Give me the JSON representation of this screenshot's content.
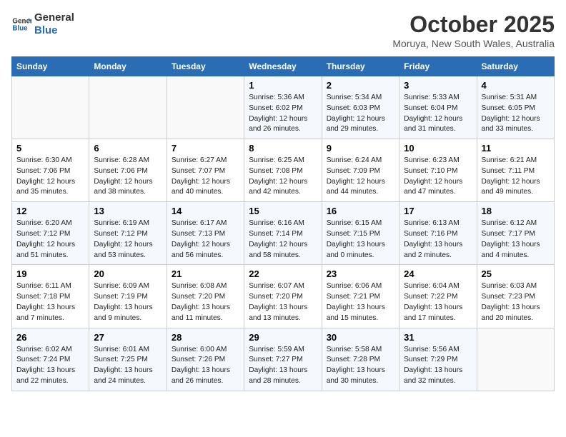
{
  "header": {
    "logo_line1": "General",
    "logo_line2": "Blue",
    "month": "October 2025",
    "location": "Moruya, New South Wales, Australia"
  },
  "weekdays": [
    "Sunday",
    "Monday",
    "Tuesday",
    "Wednesday",
    "Thursday",
    "Friday",
    "Saturday"
  ],
  "weeks": [
    [
      {
        "day": "",
        "info": ""
      },
      {
        "day": "",
        "info": ""
      },
      {
        "day": "",
        "info": ""
      },
      {
        "day": "1",
        "info": "Sunrise: 5:36 AM\nSunset: 6:02 PM\nDaylight: 12 hours\nand 26 minutes."
      },
      {
        "day": "2",
        "info": "Sunrise: 5:34 AM\nSunset: 6:03 PM\nDaylight: 12 hours\nand 29 minutes."
      },
      {
        "day": "3",
        "info": "Sunrise: 5:33 AM\nSunset: 6:04 PM\nDaylight: 12 hours\nand 31 minutes."
      },
      {
        "day": "4",
        "info": "Sunrise: 5:31 AM\nSunset: 6:05 PM\nDaylight: 12 hours\nand 33 minutes."
      }
    ],
    [
      {
        "day": "5",
        "info": "Sunrise: 6:30 AM\nSunset: 7:06 PM\nDaylight: 12 hours\nand 35 minutes."
      },
      {
        "day": "6",
        "info": "Sunrise: 6:28 AM\nSunset: 7:06 PM\nDaylight: 12 hours\nand 38 minutes."
      },
      {
        "day": "7",
        "info": "Sunrise: 6:27 AM\nSunset: 7:07 PM\nDaylight: 12 hours\nand 40 minutes."
      },
      {
        "day": "8",
        "info": "Sunrise: 6:25 AM\nSunset: 7:08 PM\nDaylight: 12 hours\nand 42 minutes."
      },
      {
        "day": "9",
        "info": "Sunrise: 6:24 AM\nSunset: 7:09 PM\nDaylight: 12 hours\nand 44 minutes."
      },
      {
        "day": "10",
        "info": "Sunrise: 6:23 AM\nSunset: 7:10 PM\nDaylight: 12 hours\nand 47 minutes."
      },
      {
        "day": "11",
        "info": "Sunrise: 6:21 AM\nSunset: 7:11 PM\nDaylight: 12 hours\nand 49 minutes."
      }
    ],
    [
      {
        "day": "12",
        "info": "Sunrise: 6:20 AM\nSunset: 7:12 PM\nDaylight: 12 hours\nand 51 minutes."
      },
      {
        "day": "13",
        "info": "Sunrise: 6:19 AM\nSunset: 7:12 PM\nDaylight: 12 hours\nand 53 minutes."
      },
      {
        "day": "14",
        "info": "Sunrise: 6:17 AM\nSunset: 7:13 PM\nDaylight: 12 hours\nand 56 minutes."
      },
      {
        "day": "15",
        "info": "Sunrise: 6:16 AM\nSunset: 7:14 PM\nDaylight: 12 hours\nand 58 minutes."
      },
      {
        "day": "16",
        "info": "Sunrise: 6:15 AM\nSunset: 7:15 PM\nDaylight: 13 hours\nand 0 minutes."
      },
      {
        "day": "17",
        "info": "Sunrise: 6:13 AM\nSunset: 7:16 PM\nDaylight: 13 hours\nand 2 minutes."
      },
      {
        "day": "18",
        "info": "Sunrise: 6:12 AM\nSunset: 7:17 PM\nDaylight: 13 hours\nand 4 minutes."
      }
    ],
    [
      {
        "day": "19",
        "info": "Sunrise: 6:11 AM\nSunset: 7:18 PM\nDaylight: 13 hours\nand 7 minutes."
      },
      {
        "day": "20",
        "info": "Sunrise: 6:09 AM\nSunset: 7:19 PM\nDaylight: 13 hours\nand 9 minutes."
      },
      {
        "day": "21",
        "info": "Sunrise: 6:08 AM\nSunset: 7:20 PM\nDaylight: 13 hours\nand 11 minutes."
      },
      {
        "day": "22",
        "info": "Sunrise: 6:07 AM\nSunset: 7:20 PM\nDaylight: 13 hours\nand 13 minutes."
      },
      {
        "day": "23",
        "info": "Sunrise: 6:06 AM\nSunset: 7:21 PM\nDaylight: 13 hours\nand 15 minutes."
      },
      {
        "day": "24",
        "info": "Sunrise: 6:04 AM\nSunset: 7:22 PM\nDaylight: 13 hours\nand 17 minutes."
      },
      {
        "day": "25",
        "info": "Sunrise: 6:03 AM\nSunset: 7:23 PM\nDaylight: 13 hours\nand 20 minutes."
      }
    ],
    [
      {
        "day": "26",
        "info": "Sunrise: 6:02 AM\nSunset: 7:24 PM\nDaylight: 13 hours\nand 22 minutes."
      },
      {
        "day": "27",
        "info": "Sunrise: 6:01 AM\nSunset: 7:25 PM\nDaylight: 13 hours\nand 24 minutes."
      },
      {
        "day": "28",
        "info": "Sunrise: 6:00 AM\nSunset: 7:26 PM\nDaylight: 13 hours\nand 26 minutes."
      },
      {
        "day": "29",
        "info": "Sunrise: 5:59 AM\nSunset: 7:27 PM\nDaylight: 13 hours\nand 28 minutes."
      },
      {
        "day": "30",
        "info": "Sunrise: 5:58 AM\nSunset: 7:28 PM\nDaylight: 13 hours\nand 30 minutes."
      },
      {
        "day": "31",
        "info": "Sunrise: 5:56 AM\nSunset: 7:29 PM\nDaylight: 13 hours\nand 32 minutes."
      },
      {
        "day": "",
        "info": ""
      }
    ]
  ]
}
